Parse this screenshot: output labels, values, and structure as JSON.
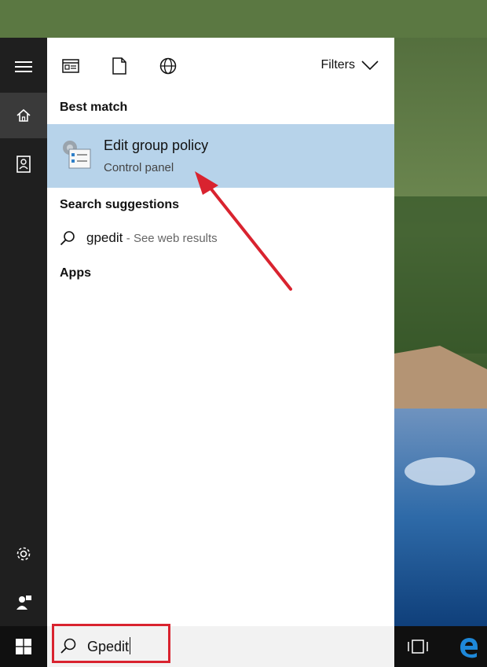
{
  "toolbar": {
    "filters_label": "Filters"
  },
  "sections": {
    "best_match": "Best match",
    "search_suggestions": "Search suggestions",
    "apps": "Apps"
  },
  "best_match_item": {
    "title": "Edit group policy",
    "subtitle": "Control panel"
  },
  "suggestion": {
    "term": "gpedit",
    "note": "- See web results"
  },
  "search_box": {
    "value": "Gpedit"
  },
  "icons": {
    "rail": [
      "hamburger-icon",
      "home-icon",
      "notebook-icon",
      "settings-icon",
      "feedback-icon"
    ],
    "toolbar": [
      "apps-icon",
      "documents-icon",
      "web-icon",
      "chevron-down-icon"
    ],
    "taskbar": [
      "windows-logo-icon",
      "search-icon",
      "task-view-icon",
      "edge-icon"
    ]
  },
  "colors": {
    "rail_bg": "#1f1f1f",
    "selected_bg": "#b7d3ea",
    "taskbar_bg": "#101010",
    "annotation_red": "#d9232f",
    "edge_blue": "#1e88d9"
  }
}
